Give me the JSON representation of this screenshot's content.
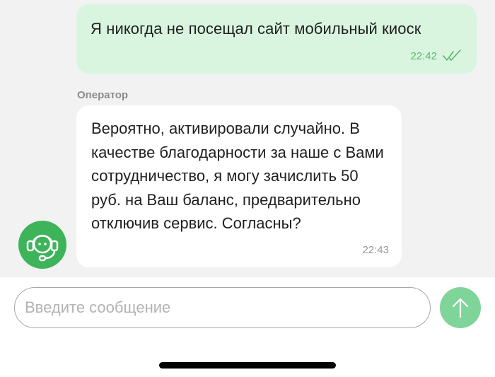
{
  "chat": {
    "outgoing": {
      "text": "Я никогда не посещал сайт мобильный киоск",
      "time": "22:42",
      "status_icon": "double-check-icon"
    },
    "incoming": {
      "sender": "Оператор",
      "text": "Вероятно, активировали случайно. В качестве благодарности за наше с Вами сотрудничество, я могу зачислить 50 руб. на Ваш баланс, предварительно отключив сервис. Согласны?",
      "time": "22:43",
      "avatar_icon": "operator-headset-icon"
    }
  },
  "composer": {
    "placeholder": "Введите сообщение",
    "send_icon": "arrow-up-icon"
  },
  "colors": {
    "outgoing_bubble": "#d9f5df",
    "accent_green": "#3db45a",
    "send_button": "#7fd49a",
    "chat_background": "#f1f2f1"
  }
}
